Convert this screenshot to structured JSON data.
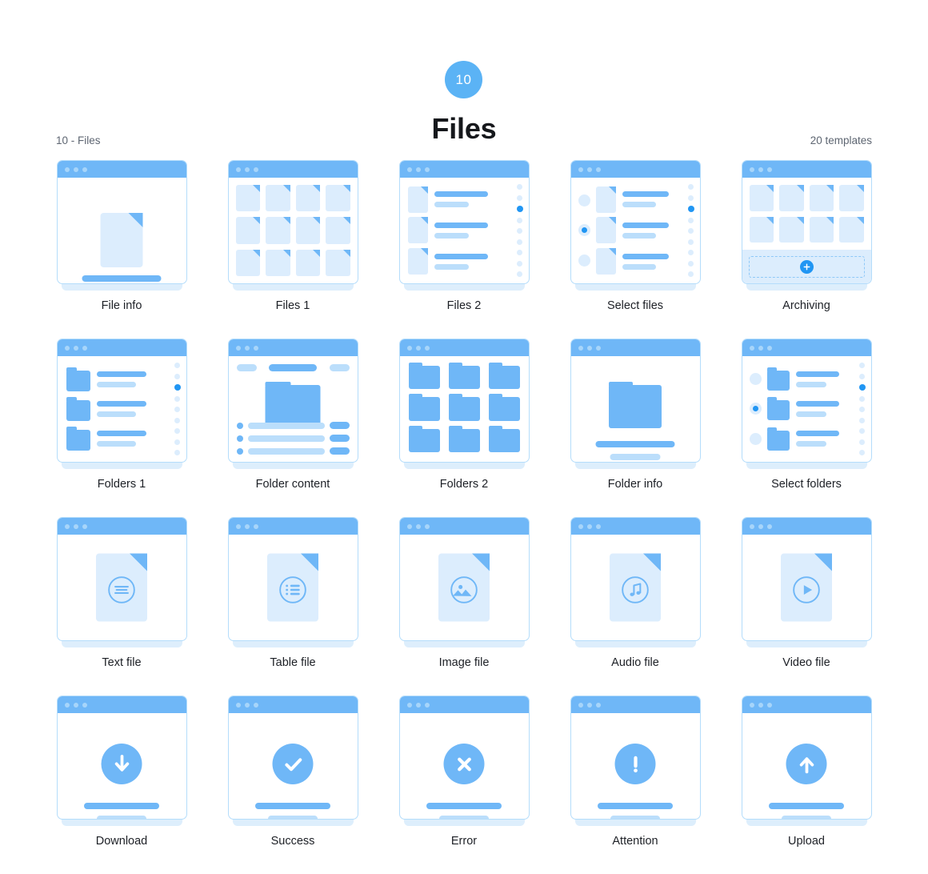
{
  "header": {
    "badge_number": "10",
    "title": "Files",
    "breadcrumb_left": "10 - Files",
    "count_right": "20 templates",
    "accent": "#6FB7F7",
    "accent_dark": "#2196F3",
    "accent_light": "#DCEDFD"
  },
  "cards": [
    {
      "label": "File info",
      "icon": "file-info-icon"
    },
    {
      "label": "Files 1",
      "icon": "files-grid-icon"
    },
    {
      "label": "Files 2",
      "icon": "files-list-icon"
    },
    {
      "label": "Select files",
      "icon": "select-files-icon"
    },
    {
      "label": "Archiving",
      "icon": "archiving-icon"
    },
    {
      "label": "Folders 1",
      "icon": "folders-list-icon"
    },
    {
      "label": "Folder content",
      "icon": "folder-content-icon"
    },
    {
      "label": "Folders 2",
      "icon": "folders-grid-icon"
    },
    {
      "label": "Folder info",
      "icon": "folder-info-icon"
    },
    {
      "label": "Select folders",
      "icon": "select-folders-icon"
    },
    {
      "label": "Text file",
      "icon": "text-file-icon"
    },
    {
      "label": "Table file",
      "icon": "table-file-icon"
    },
    {
      "label": "Image file",
      "icon": "image-file-icon"
    },
    {
      "label": "Audio file",
      "icon": "audio-file-icon"
    },
    {
      "label": "Video file",
      "icon": "video-file-icon"
    },
    {
      "label": "Download",
      "icon": "download-arrow-icon"
    },
    {
      "label": "Success",
      "icon": "check-icon"
    },
    {
      "label": "Error",
      "icon": "close-x-icon"
    },
    {
      "label": "Attention",
      "icon": "exclamation-icon"
    },
    {
      "label": "Upload",
      "icon": "upload-arrow-icon"
    }
  ],
  "window_chrome": {
    "dot_count": 3
  },
  "scrollbar": {
    "dots": 9,
    "active_index": 2
  },
  "selection": {
    "items": 3,
    "selected_index": 1
  }
}
